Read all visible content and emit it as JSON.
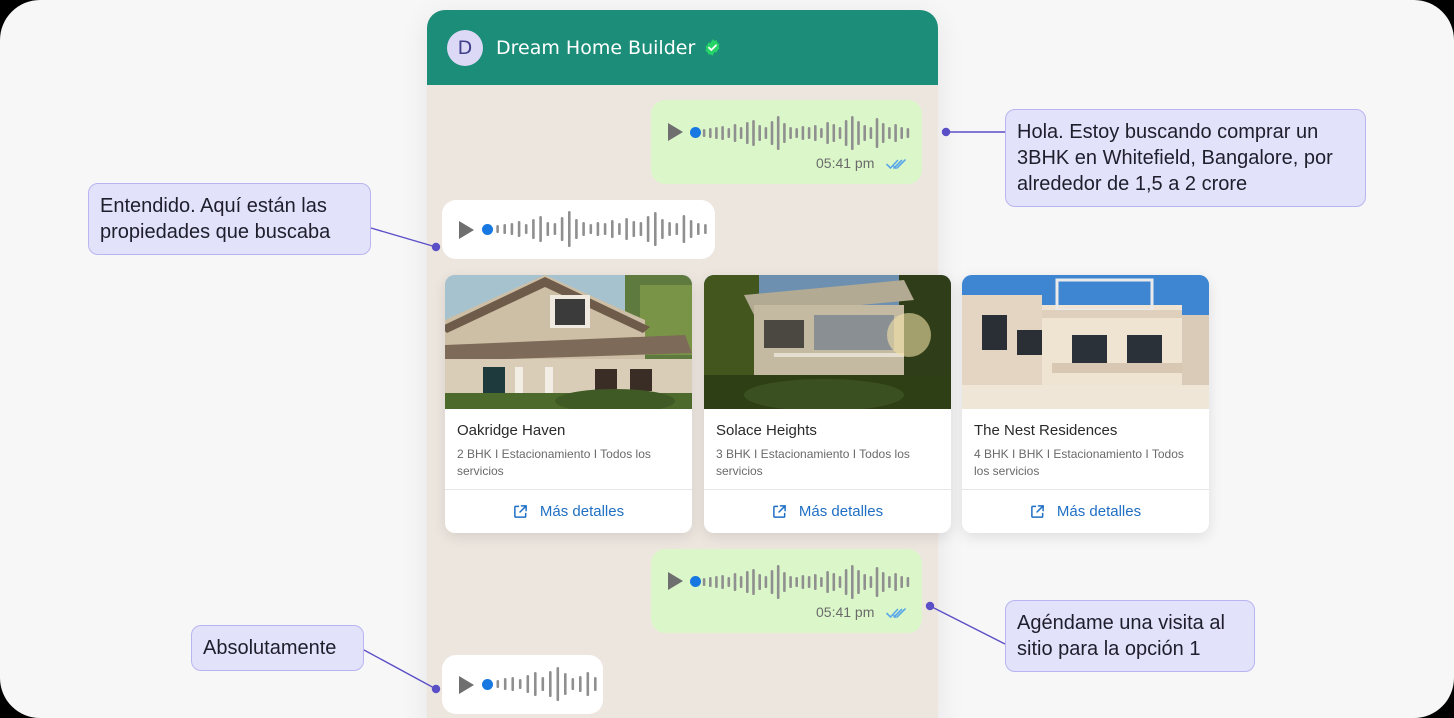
{
  "chat": {
    "contact_initial": "D",
    "contact_name": "Dream Home Builder",
    "header_color": "#1b8d78",
    "verified_color": "#25d366"
  },
  "messages": [
    {
      "direction": "outgoing",
      "type": "voice",
      "time": "05:41 pm",
      "read": true
    },
    {
      "direction": "incoming",
      "type": "voice"
    },
    {
      "direction": "outgoing",
      "type": "voice",
      "time": "05:41 pm",
      "read": true
    },
    {
      "direction": "incoming",
      "type": "voice"
    }
  ],
  "properties": [
    {
      "name": "Oakridge Haven",
      "details": "2 BHK  I  Estacionamiento  I Todos los servicios",
      "link_label": "Más detalles"
    },
    {
      "name": "Solace Heights",
      "details": "3 BHK  I  Estacionamiento  I Todos los servicios",
      "link_label": "Más detalles"
    },
    {
      "name": "The Nest Residences",
      "details": "4 BHK  I  BHK  I  Estacionamiento  I Todos los servicios",
      "link_label": "Más detalles"
    }
  ],
  "annotations": {
    "user_request": "Hola. Estoy buscando comprar un 3BHK en Whitefield, Bangalore, por alrededor de 1,5 a 2 crore",
    "bot_reply": "Entendido. Aquí están las propiedades que buscaba",
    "user_followup": "Agéndame una visita al sitio para la opción 1",
    "bot_confirm": "Absolutamente"
  },
  "colors": {
    "outgoing_bubble": "#dbf7c9",
    "incoming_bubble": "#ffffff",
    "link": "#1f6fc4",
    "callout_bg": "#e3e2fb",
    "callout_border": "#b9b5f0",
    "connector": "#5b4fc7"
  }
}
